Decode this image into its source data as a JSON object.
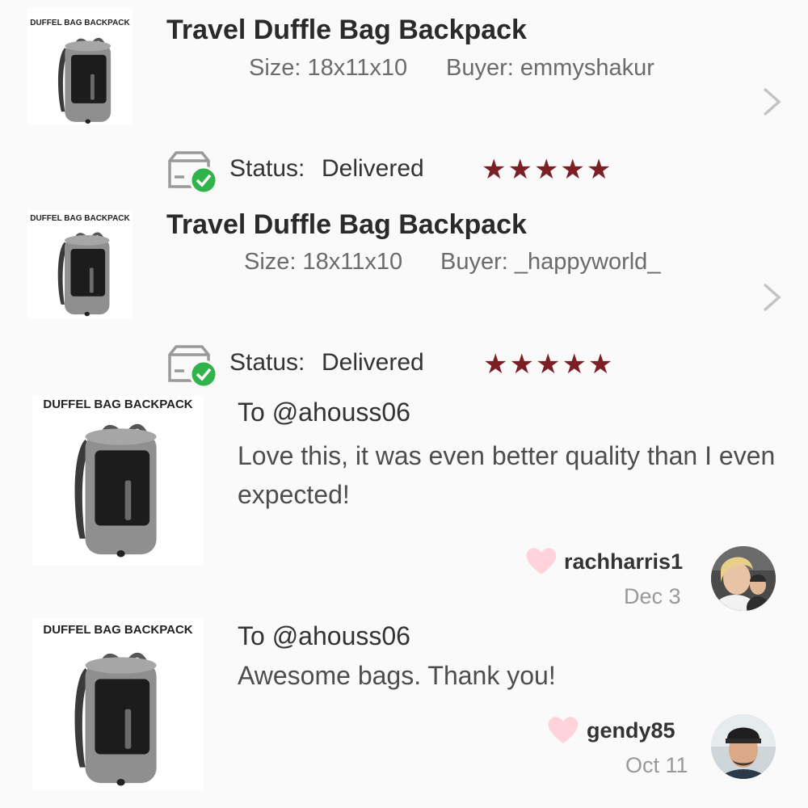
{
  "orders": [
    {
      "thumb_label": "DUFFEL BAG BACKPACK",
      "title": "Travel Duffle Bag Backpack",
      "size": "Size: 18x11x10",
      "buyer": "Buyer: emmyshakur",
      "status_label": "Status:",
      "status_value": "Delivered",
      "rating": 5,
      "stars": "★★★★★"
    },
    {
      "thumb_label": "DUFFEL BAG BACKPACK",
      "title": "Travel Duffle Bag Backpack",
      "size": "Size: 18x11x10",
      "buyer": "Buyer: _happyworld_",
      "status_label": "Status:",
      "status_value": "Delivered",
      "rating": 5,
      "stars": "★★★★★"
    }
  ],
  "reviews": [
    {
      "thumb_label": "DUFFEL BAG BACKPACK",
      "to": "To @ahouss06",
      "message": "Love this, it was even better quality than I even expected!",
      "username": "rachharris1",
      "date": "Dec 3"
    },
    {
      "thumb_label": "DUFFEL BAG BACKPACK",
      "to": "To @ahouss06",
      "message": "Awesome bags. Thank you!",
      "username": "gendy85",
      "date": "Oct 11"
    }
  ],
  "colors": {
    "star": "#7b1f24",
    "heart": "#ffd3d9",
    "check": "#2fb34a",
    "chevron": "#c4c4c4"
  }
}
